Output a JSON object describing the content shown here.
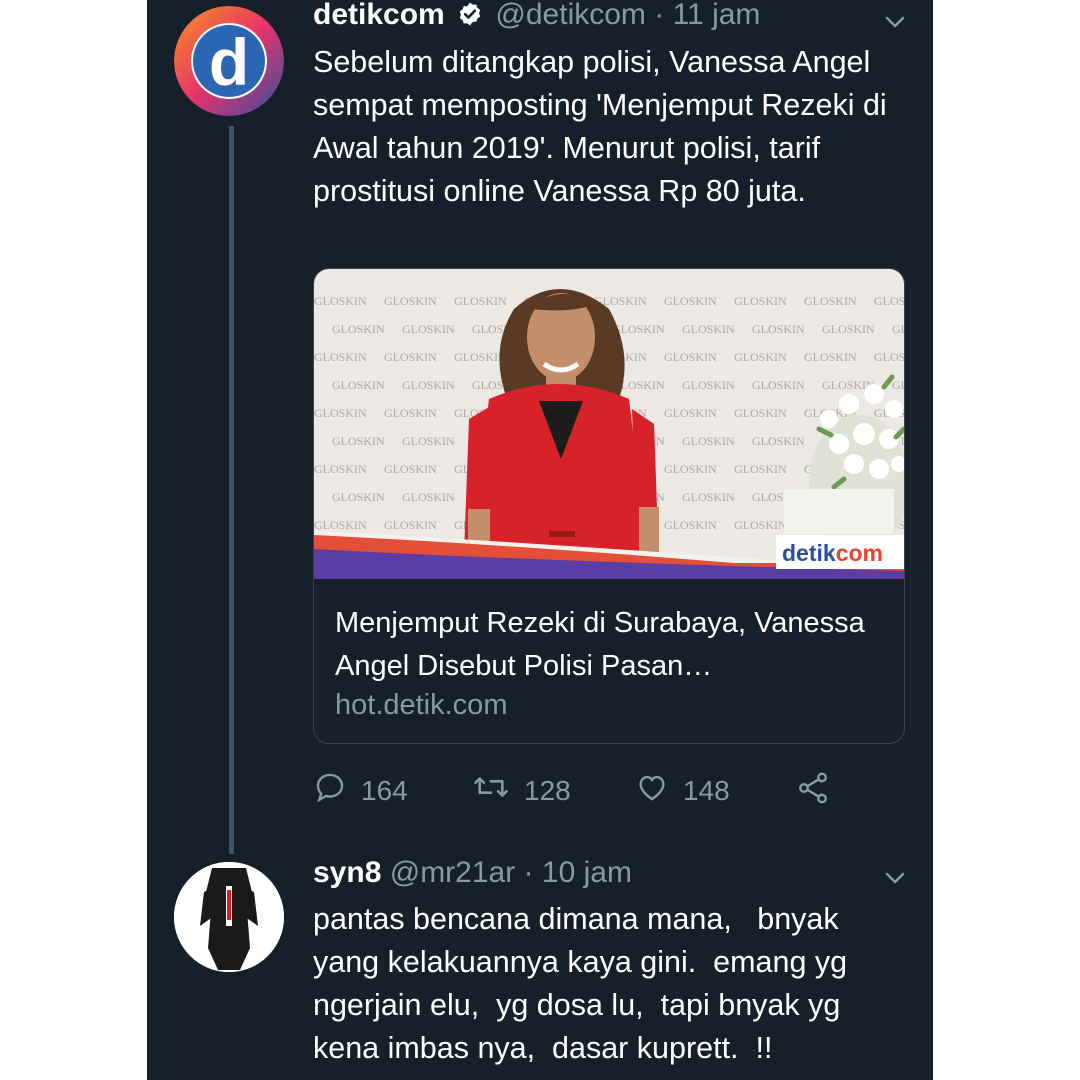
{
  "tweet": {
    "author_name": "detikcom",
    "handle": "@detikcom",
    "separator": "·",
    "time": "11 jam",
    "text": "Sebelum ditangkap polisi, Vanessa Angel sempat memposting 'Menjemput Rezeki di Awal tahun 2019'. Menurut polisi, tarif prostitusi online Vanessa Rp 80 juta.",
    "avatar_letter": "d",
    "card": {
      "image_watermark_detik": "detik",
      "image_watermark_com": "com",
      "backdrop_brand": "GLOSKIN",
      "title": "Menjemput Rezeki di Surabaya, Vanessa Angel Disebut Polisi Pasan…",
      "domain": "hot.detik.com"
    },
    "actions": {
      "replies": "164",
      "retweets": "128",
      "likes": "148"
    }
  },
  "reply": {
    "author_name": "syn8",
    "handle": "@mr21ar",
    "separator": "·",
    "time": "10 jam",
    "text": "pantas bencana dimana mana,   bnyak yang kelakuannya kaya gini.  emang yg ngerjain elu,  yg dosa lu,  tapi bnyak yg kena imbas nya,  dasar kuprett.  !!"
  },
  "colors": {
    "background": "#15202b",
    "primary_text": "#ffffff",
    "secondary_text": "#8899a6",
    "thread_line": "#3d5466",
    "card_border": "#38444d",
    "verified_badge": "#ffffff"
  },
  "icons": [
    "verified-badge-icon",
    "chevron-down-icon",
    "reply-icon",
    "retweet-icon",
    "like-icon",
    "share-icon"
  ]
}
